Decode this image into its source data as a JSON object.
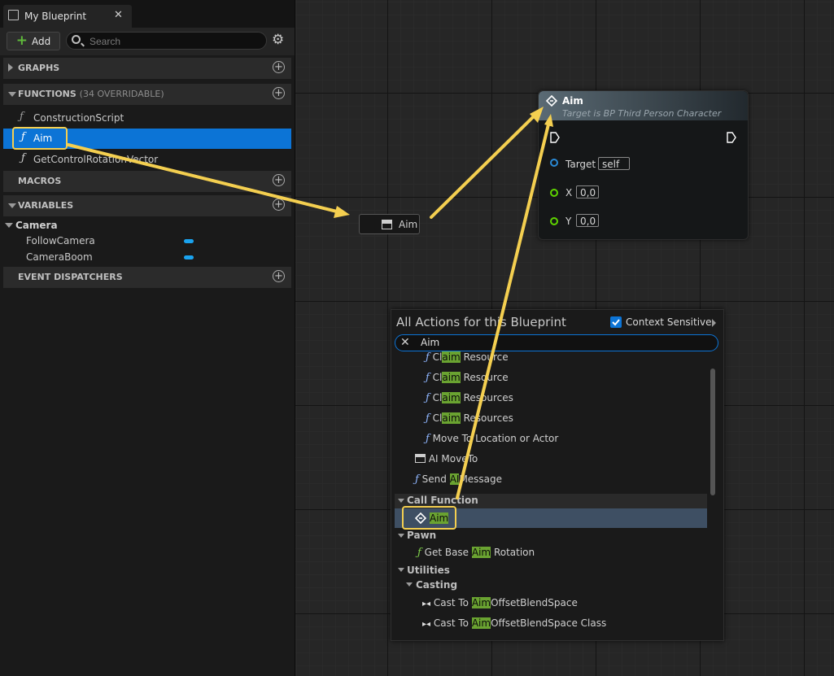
{
  "tab": {
    "title": "My Blueprint",
    "close": "✕"
  },
  "toolbar": {
    "add_label": "Add",
    "search_placeholder": "Search"
  },
  "sections": {
    "graphs": "GRAPHS",
    "functions": "FUNCTIONS",
    "functions_sub": "(34 OVERRIDABLE)",
    "macros": "MACROS",
    "variables": "VARIABLES",
    "event_dispatchers": "EVENT DISPATCHERS"
  },
  "functions": [
    "ConstructionScript",
    "Aim",
    "GetControlRotationVector"
  ],
  "variables": {
    "category": "Camera",
    "items": [
      "FollowCamera",
      "CameraBoom"
    ],
    "type_color": "#1aa3ef"
  },
  "aim_node": {
    "title": "Aim",
    "subtitle": "Target is BP Third Person Character",
    "pins": [
      {
        "label": "Target",
        "value": "self",
        "color": "#2a8ad6"
      },
      {
        "label": "X",
        "value": "0,0",
        "color": "#5fd400"
      },
      {
        "label": "Y",
        "value": "0,0",
        "color": "#5fd400"
      }
    ]
  },
  "var_node": {
    "label": "Aim"
  },
  "action_menu": {
    "title": "All Actions for this Blueprint",
    "context_sensitive": "Context Sensitive",
    "search_value": "Aim",
    "items": [
      {
        "pre": "Cl",
        "match": "aim",
        "post": " Resource"
      },
      {
        "pre": "Cl",
        "match": "aim",
        "post": " Resource"
      },
      {
        "pre": "Cl",
        "match": "aim",
        "post": " Resources"
      },
      {
        "pre": "Cl",
        "match": "aim",
        "post": " Resources"
      },
      {
        "pre": "Move To Location or Actor",
        "match": "",
        "post": ""
      },
      {
        "pre": "AI MoveTo",
        "match": "",
        "post": ""
      },
      {
        "pre": "Send ",
        "match": "AI",
        "post": "Message"
      }
    ],
    "call_function_category": "Call Function",
    "call_function_item": "Aim",
    "pawn_category": "Pawn",
    "pawn_item": {
      "pre": "Get Base ",
      "match": "Aim",
      "post": " Rotation"
    },
    "utilities_category": "Utilities",
    "casting_category": "Casting",
    "casting_items": [
      {
        "pre": "Cast To ",
        "match": "Aim",
        "post": "OffsetBlendSpace"
      },
      {
        "pre": "Cast To ",
        "match": "Aim",
        "post": "OffsetBlendSpace Class"
      }
    ]
  },
  "colors": {
    "accent": "#0c74d6",
    "highlight": "#f4cf50",
    "match": "#6aa331"
  }
}
